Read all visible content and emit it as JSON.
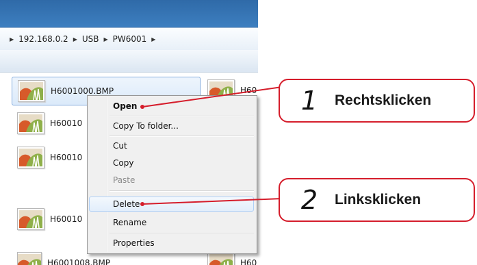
{
  "breadcrumb": [
    "192.168.0.2",
    "USB",
    "PW6001"
  ],
  "files": [
    {
      "name": "H6001000.BMP",
      "selected": true
    },
    {
      "name": "H60010",
      "selected": false
    },
    {
      "name": "H60010",
      "selected": false
    },
    {
      "name": "H60010",
      "selected": false
    },
    {
      "name": "H6001008.BMP",
      "selected": false
    }
  ],
  "files_col2": [
    {
      "name": "H60"
    },
    {
      "name": "H60"
    }
  ],
  "context_menu": {
    "open": "Open",
    "copy_to_folder": "Copy To folder...",
    "cut": "Cut",
    "copy": "Copy",
    "paste": "Paste",
    "delete": "Delete",
    "rename": "Rename",
    "properties": "Properties"
  },
  "callouts": [
    {
      "number": "1",
      "text": "Rechtsklicken"
    },
    {
      "number": "2",
      "text": "Linksklicken"
    }
  ],
  "colors": {
    "callout_border": "#d51d2b",
    "title_bar": "#2f6aa8"
  },
  "icons": {
    "breadcrumb_separator": "triangle-right",
    "file": "image-thumbnail"
  }
}
